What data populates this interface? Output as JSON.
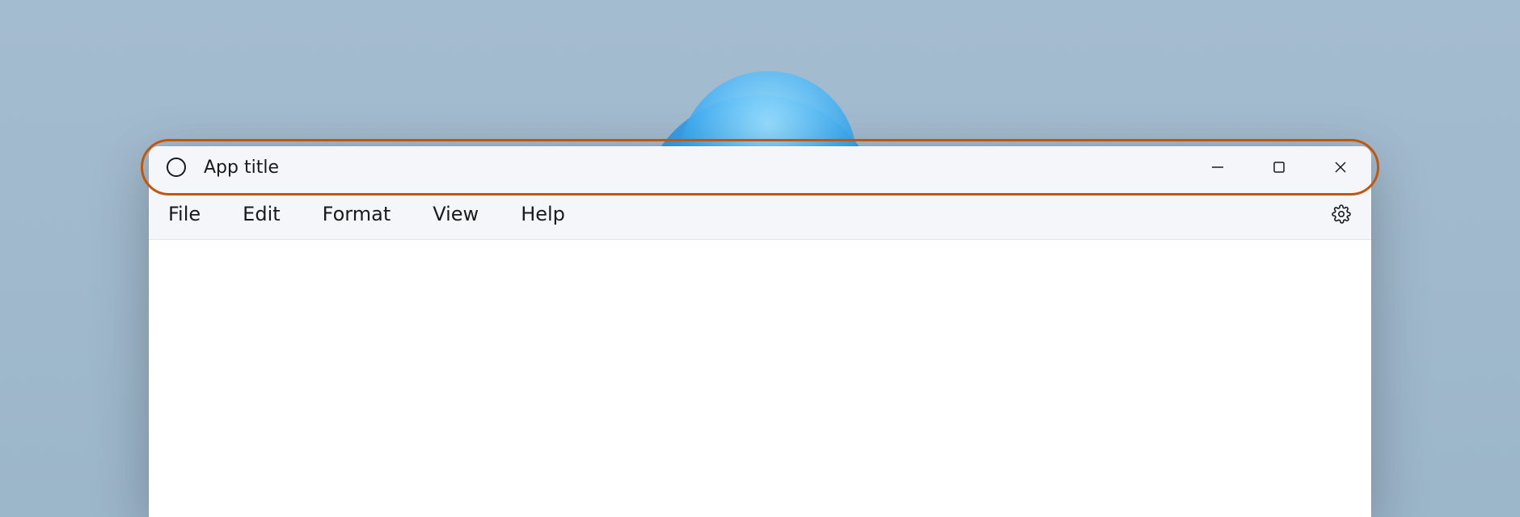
{
  "titlebar": {
    "app_icon": "circle-icon",
    "title": "App title",
    "minimize_icon": "minimize-icon",
    "maximize_icon": "maximize-icon",
    "close_icon": "close-icon"
  },
  "menubar": {
    "items": [
      "File",
      "Edit",
      "Format",
      "View",
      "Help"
    ],
    "settings_icon": "gear-icon"
  },
  "colors": {
    "highlight": "#c2570c",
    "titlebar_bg": "#f4f6f9",
    "desktop_bg": "#9cb6ca"
  }
}
